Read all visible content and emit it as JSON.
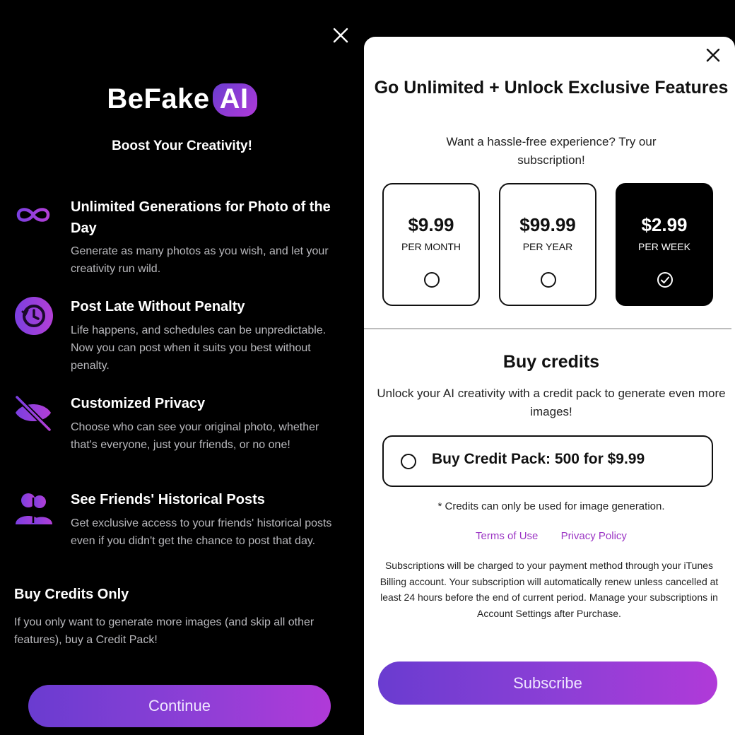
{
  "left": {
    "brand_name": "BeFake",
    "brand_badge": "AI",
    "tagline": "Boost Your Creativity!",
    "features": [
      {
        "icon": "infinity-icon",
        "title": "Unlimited Generations for Photo of the Day",
        "description": "Generate as many photos as you wish, and let your creativity run wild."
      },
      {
        "icon": "clock-rewind-icon",
        "title": "Post Late Without Penalty",
        "description": "Life happens, and schedules can be unpredictable. Now you can post when it suits you best without penalty."
      },
      {
        "icon": "eye-off-icon",
        "title": "Customized Privacy",
        "description": "Choose who can see your original photo, whether that's everyone, just your friends, or no one!"
      },
      {
        "icon": "friends-icon",
        "title": "See Friends' Historical Posts",
        "description": "Get exclusive access to your friends' historical posts even if you didn't get the chance to post that day."
      }
    ],
    "credits_only_title": "Buy Credits Only",
    "credits_only_description": "If you only want to generate more images (and skip all other features), buy a Credit Pack!",
    "continue_label": "Continue"
  },
  "right": {
    "title": "Go Unlimited + Unlock Exclusive Features",
    "subtitle": "Want a hassle-free experience? Try our subscription!",
    "plans": [
      {
        "price": "$9.99",
        "period": "PER MONTH",
        "selected": false
      },
      {
        "price": "$99.99",
        "period": "PER YEAR",
        "selected": false
      },
      {
        "price": "$2.99",
        "period": "PER WEEK",
        "selected": true
      }
    ],
    "credits_title": "Buy credits",
    "credits_description": "Unlock your AI creativity with a credit pack to generate even more images!",
    "credit_pack_label": "Buy Credit Pack: 500 for $9.99",
    "credit_note": "* Credits can only be used for image generation.",
    "terms_label": "Terms of Use",
    "privacy_label": "Privacy Policy",
    "legal_text": "Subscriptions will be charged to your payment method through your iTunes Billing account. Your subscription will automatically renew unless cancelled at least 24 hours before the end of current period. Manage your subscriptions in Account Settings after Purchase.",
    "subscribe_label": "Subscribe"
  },
  "colors": {
    "accent_purple": "#8d3fd6",
    "gradient_start": "#6a3cd0",
    "gradient_end": "#b03ad8",
    "link_purple": "#9b35c4"
  }
}
